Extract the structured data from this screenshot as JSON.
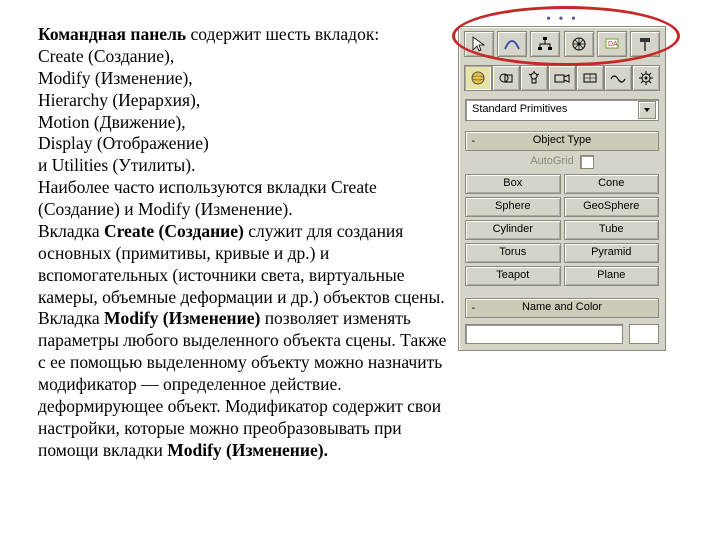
{
  "text": {
    "boldLead": "Командная панель ",
    "lead": "содержит шесть вкладок:",
    "lines": [
      "Create (Создание),",
      "Modify (Изменение),",
      "Hierarchy (Иерархия),",
      "Motion (Движение),",
      "Display (Отображение)",
      "и Utilities (Утилиты)."
    ],
    "p2": " Наиболее часто используются вкладки Create (Создание) и Modify (Изменение).",
    "p3a": "Вкладка ",
    "p3b": "Create (Создание)",
    "p3c": " служит для создания основных (примитивы, кривые и др.) и вспомогательных (источники света, виртуальные камеры, объемные деформации и др.) объектов сцены. Вкладка ",
    "p3d": "Modify (Изменение)",
    "p3e": " позволяет изменять параметры любого выделенного объекта сцены. Также с ее помощью выделенному объекту можно назначить модификатор — определенное действие. деформирующее объект. Модификатор содержит свои настройки, которые можно преобразовывать при помощи вкладки ",
    "p3f": "Modify (Изменение)."
  },
  "panel": {
    "dots": "• • •",
    "dropdown": "Standard Primitives",
    "objectTypeTitle": "Object Type",
    "autoGrid": "AutoGrid",
    "buttons": [
      "Box",
      "Cone",
      "Sphere",
      "GeoSphere",
      "Cylinder",
      "Tube",
      "Torus",
      "Pyramid",
      "Teapot",
      "Plane"
    ],
    "nameColorTitle": "Name and Color",
    "minus": "-"
  }
}
